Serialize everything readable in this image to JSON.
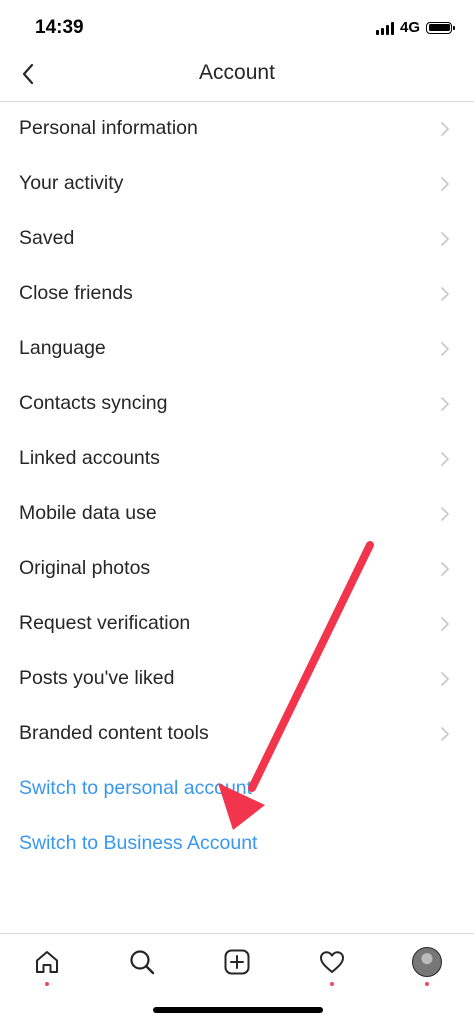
{
  "status_bar": {
    "time": "14:39",
    "network": "4G"
  },
  "header": {
    "title": "Account",
    "back_icon": "chevron-left-icon"
  },
  "menu_items": [
    {
      "label": "Personal information"
    },
    {
      "label": "Your activity"
    },
    {
      "label": "Saved"
    },
    {
      "label": "Close friends"
    },
    {
      "label": "Language"
    },
    {
      "label": "Contacts syncing"
    },
    {
      "label": "Linked accounts"
    },
    {
      "label": "Mobile data use"
    },
    {
      "label": "Original photos"
    },
    {
      "label": "Request verification"
    },
    {
      "label": "Posts you've liked"
    },
    {
      "label": "Branded content tools"
    }
  ],
  "links": {
    "switch_personal": "Switch to personal account",
    "switch_business": "Switch to Business Account"
  },
  "colors": {
    "link": "#3897f0",
    "annotation_arrow": "#f2344c",
    "notification_dot": "#ed4956"
  },
  "tab_bar": {
    "icons": [
      "home-icon",
      "search-icon",
      "add-post-icon",
      "heart-icon",
      "profile-avatar"
    ]
  }
}
